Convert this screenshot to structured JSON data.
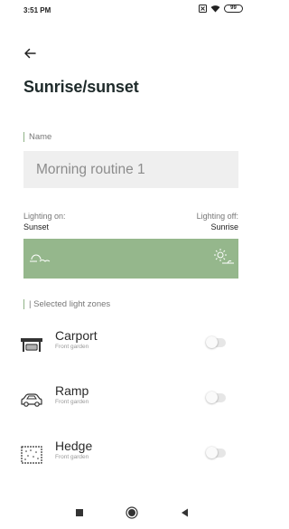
{
  "status_bar": {
    "time": "3:51 PM",
    "battery": "99"
  },
  "header": {
    "back_icon": "arrow-left-icon",
    "title": "Sunrise/sunset"
  },
  "name_section": {
    "label": "Name",
    "value": "Morning routine 1"
  },
  "lighting": {
    "on_caption": "Lighting on:",
    "on_value": "Sunset",
    "off_caption": "Lighting off:",
    "off_value": "Sunrise",
    "band_color": "#95b78c",
    "on_icon": "sunset-icon",
    "off_icon": "sunrise-icon"
  },
  "zones": {
    "label": "| Selected light zones",
    "items": [
      {
        "name": "Carport",
        "sub": "Front garden",
        "icon": "carport-icon",
        "enabled": false
      },
      {
        "name": "Ramp",
        "sub": "Front garden",
        "icon": "car-icon",
        "enabled": false
      },
      {
        "name": "Hedge",
        "sub": "Front garden",
        "icon": "hedge-icon",
        "enabled": false
      }
    ]
  },
  "nav": {
    "recent_icon": "square-icon",
    "home_icon": "circle-icon",
    "back_icon": "triangle-back-icon"
  },
  "colors": {
    "accent": "#95b78c",
    "input_bg": "#efefef"
  }
}
